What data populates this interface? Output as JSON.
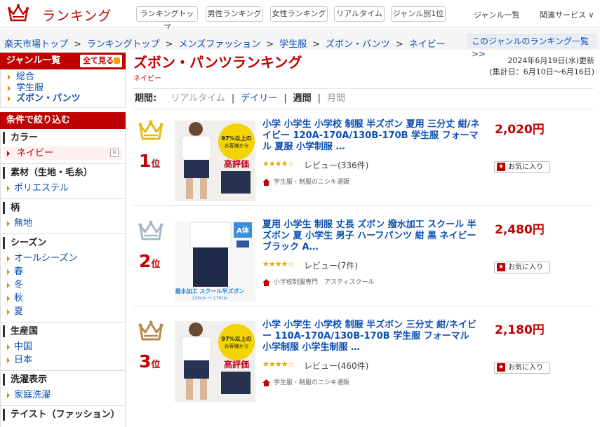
{
  "header": {
    "logo_text": "ランキング",
    "nav": [
      "ランキングトップ",
      "男性ランキング",
      "女性ランキング",
      "リアルタイム",
      "ジャンル別1位"
    ],
    "genre_list": "ジャンル一覧",
    "related": "関連サービス ∨"
  },
  "breadcrumb": [
    "楽天市場トップ",
    "ランキングトップ",
    "メンズファッション",
    "学生服",
    "ズボン・パンツ",
    "ネイビー"
  ],
  "breadcrumb_right": "このジャンルのランキング一覧 >>",
  "sidebar": {
    "genre_title": "ジャンル一覧",
    "all_button": "全て見る",
    "genres": [
      "総合",
      "学生服",
      "ズボン・パンツ"
    ],
    "filter_title": "条件で絞り込む",
    "sections": [
      {
        "title": "カラー",
        "items": [
          "ネイビー"
        ],
        "selected": 0
      },
      {
        "title": "素材（生地・毛糸）",
        "items": [
          "ポリエステル"
        ]
      },
      {
        "title": "柄",
        "items": [
          "無地"
        ]
      },
      {
        "title": "シーズン",
        "items": [
          "オールシーズン",
          "春",
          "冬",
          "秋",
          "夏"
        ]
      },
      {
        "title": "生産国",
        "items": [
          "中国",
          "日本"
        ]
      },
      {
        "title": "洗濯表示",
        "items": [
          "家庭洗濯"
        ]
      },
      {
        "title": "テイスト（ファッション）",
        "items": []
      }
    ]
  },
  "main": {
    "title": "ズボン・パンツランキング",
    "subtitle": "ネイビー",
    "updated": "2024年6月19日(水)更新",
    "range": "(集計日：6月10日〜6月16日)",
    "period_label": "期間:",
    "periods": [
      "リアルタイム",
      "デイリー",
      "週間",
      "月間"
    ]
  },
  "items": [
    {
      "rank": "1",
      "rank_suffix": "位",
      "name": "小学 小学生 小学校 制服 半ズボン 夏用 三分丈 紺/ネイビー 120A-170A/130B-170B 学生服 フォーマル 夏服 小学制服 …",
      "price": "2,020円",
      "stars": "★★★★☆",
      "review": "レビュー(336件)",
      "shop": "学生服・制服のニシキ通販",
      "fav": "お気に入り",
      "crown_color": "#e8b817",
      "thumb_badge": "97%以上のお客様から",
      "thumb_label": "高評価"
    },
    {
      "rank": "2",
      "rank_suffix": "位",
      "name": "夏用 小学生 制服 丈長 ズボン 撥水加工 スクール 半ズボン 夏 小学生 男子 ハーフパンツ 紺 黒 ネイビー ブラック A…",
      "price": "2,480円",
      "stars": "★★★★☆",
      "review": "レビュー(7件)",
      "shop": "小学校制服専門　アスティスクール",
      "fav": "お気に入り",
      "crown_color": "#a9b8c8",
      "thumb_badge": "A体",
      "thumb_label": "撥水加工 スクール半ズボン",
      "thumb_size": "120cm ～ 170cm"
    },
    {
      "rank": "3",
      "rank_suffix": "位",
      "name": "小学 小学生 小学校 制服 半ズボン 三分丈 紺/ネイビー 110A-170A/130B-170B 学生服 フォーマル 小学制服 小学生制服 …",
      "price": "2,180円",
      "stars": "★★★★☆",
      "review": "レビュー(460件)",
      "shop": "学生服・制服のニシキ通販",
      "fav": "お気に入り",
      "crown_color": "#b98a4e",
      "thumb_badge": "97%以上のお客様から",
      "thumb_label": "高評価"
    }
  ]
}
